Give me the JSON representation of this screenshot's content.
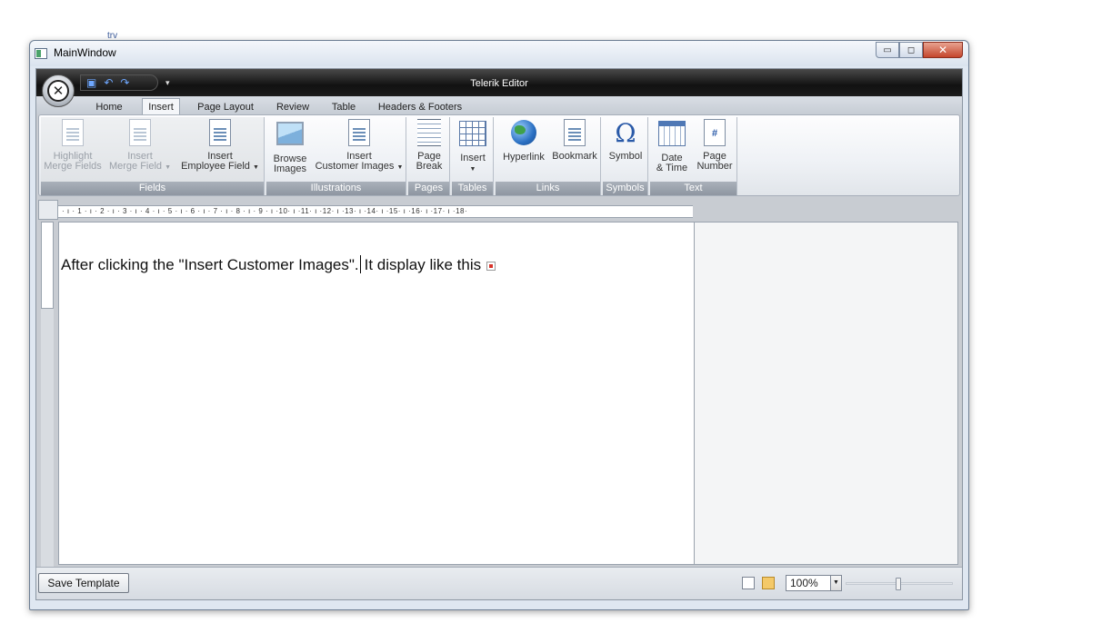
{
  "stray_text": "trv",
  "window": {
    "title": "MainWindow"
  },
  "app": {
    "title": "Telerik Editor"
  },
  "tabs": [
    {
      "label": "Home"
    },
    {
      "label": "Insert"
    },
    {
      "label": "Page Layout"
    },
    {
      "label": "Review"
    },
    {
      "label": "Table"
    },
    {
      "label": "Headers & Footers"
    }
  ],
  "active_tab": "Insert",
  "ribbon": {
    "fields": {
      "label": "Fields",
      "highlight_1": "Highlight",
      "highlight_2": "Merge Fields",
      "insert_merge_1": "Insert",
      "insert_merge_2": "Merge Field",
      "insert_emp_1": "Insert",
      "insert_emp_2": "Employee Field"
    },
    "illustrations": {
      "label": "Illustrations",
      "browse_1": "Browse",
      "browse_2": "Images",
      "cust_1": "Insert",
      "cust_2": "Customer Images"
    },
    "pages": {
      "label": "Pages",
      "pb_1": "Page",
      "pb_2": "Break"
    },
    "tables": {
      "label": "Tables",
      "insert": "Insert"
    },
    "links": {
      "label": "Links",
      "hyperlink": "Hyperlink",
      "bookmark": "Bookmark"
    },
    "symbols": {
      "label": "Symbols",
      "symbol": "Symbol"
    },
    "text": {
      "label": "Text",
      "dt_1": "Date",
      "dt_2": "& Time",
      "pn_1": "Page",
      "pn_2": "Number"
    }
  },
  "ruler_text": "· ı · 1 · ı · 2 · ı · 3 · ı · 4 · ı · 5 · ı · 6 · ı · 7 · ı · 8 · ı · 9 · ı ·10· ı ·11· ı ·12· ı ·13· ı ·14· ı ·15· ı ·16· ı ·17· ı ·18·",
  "document": {
    "text_before": "After clicking the  \"Insert Customer Images\".",
    "text_after": "It display like this"
  },
  "status": {
    "save_label": "Save Template",
    "zoom": "100%"
  }
}
